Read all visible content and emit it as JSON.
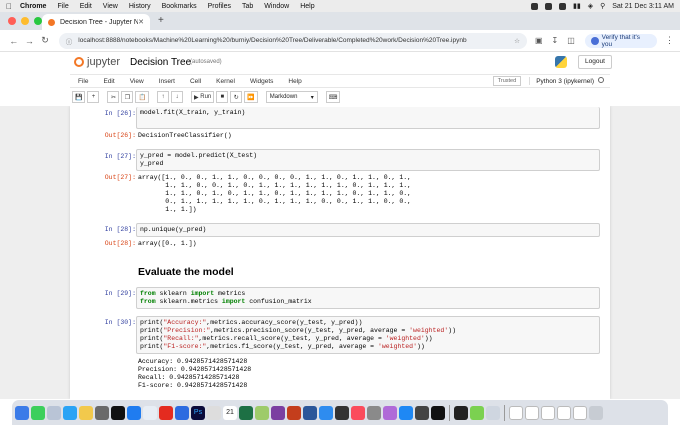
{
  "menubar": {
    "app": "Chrome",
    "items": [
      "File",
      "Edit",
      "View",
      "History",
      "Bookmarks",
      "Profiles",
      "Tab",
      "Window",
      "Help"
    ],
    "clock": "Sat 21 Dec  3:11 AM"
  },
  "browser": {
    "tab_title": "Decision Tree - Jupyter Notebo",
    "url": "localhost:8888/notebooks/Machine%20Learning%20/burniy/Decision%20Tree/Deliverable/Completed%20work/Decision%20Tree.ipynb",
    "verify_label": "Verify that it's you"
  },
  "jupyter": {
    "brand": "jupyter",
    "notebook_title": "Decision Tree",
    "save_status": "(autosaved)",
    "logout": "Logout",
    "menu": [
      "File",
      "Edit",
      "View",
      "Insert",
      "Cell",
      "Kernel",
      "Widgets",
      "Help"
    ],
    "trusted": "Trusted",
    "kernel": "Python 3 (ipykernel)",
    "run_label": "Run",
    "cell_type": "Markdown"
  },
  "cells": {
    "c26_in_prompt": "In [26]:",
    "c26_code": "model.fit(X_train, y_train)",
    "c26_out_prompt": "Out[26]:",
    "c26_output": "DecisionTreeClassifier()",
    "c27_in_prompt": "In [27]:",
    "c27_code": "y_pred = model.predict(X_test)\ny_pred",
    "c27_out_prompt": "Out[27]:",
    "c27_output": "array([1., 0., 0., 1., 1., 0., 0., 0., 0., 1., 1., 0., 1., 1., 0., 1.,\n       1., 1., 0., 0., 1., 0., 1., 1., 1., 1., 1., 1., 0., 1., 1., 1.,\n       1., 1., 0., 1., 0., 1., 1., 0., 1., 1., 1., 1., 0., 1., 1., 0.,\n       0., 1., 1., 1., 1., 1., 0., 1., 1., 1., 0., 0., 1., 1., 0., 0.,\n       1., 1.])",
    "c28_in_prompt": "In [28]:",
    "c28_code": "np.unique(y_pred)",
    "c28_out_prompt": "Out[28]:",
    "c28_output": "array([0., 1.])",
    "heading": "Evaluate the model",
    "c29_in_prompt": "In [29]:",
    "c29_line1_a": "from",
    "c29_line1_b": " sklearn ",
    "c29_line1_c": "import",
    "c29_line1_d": " metrics",
    "c29_line2_a": "from",
    "c29_line2_b": " sklearn.metrics ",
    "c29_line2_c": "import",
    "c29_line2_d": " confusion_matrix",
    "c30_in_prompt": "In [30]:",
    "c30_l1_pre": "print(",
    "c30_l1_str": "\"Accuracy:\"",
    "c30_l1_post": ",metrics.accuracy_score(y_test, y_pred))",
    "c30_l2_pre": "print(",
    "c30_l2_str": "\"Precision:\"",
    "c30_l2_mid": ",metrics.precision_score(y_test, y_pred, average = ",
    "c30_l2_str2": "'weighted'",
    "c30_l2_post": "))",
    "c30_l3_pre": "print(",
    "c30_l3_str": "\"Recall:\"",
    "c30_l3_mid": ",metrics.recall_score(y_test, y_pred, average = ",
    "c30_l3_str2": "'weighted'",
    "c30_l3_post": "))",
    "c30_l4_pre": "print(",
    "c30_l4_str": "\"F1-score:\"",
    "c30_l4_mid": ",metrics.f1_score(y_test, y_pred, average = ",
    "c30_l4_str2": "'weighted'",
    "c30_l4_post": "))",
    "c30_output": "Accuracy: 0.9428571428571428\nPrecision: 0.9428571428571428\nRecall: 0.9428571428571428\nF1-score: 0.9428571428571428"
  },
  "dock_calendar_day": "21",
  "colors": {
    "in_prompt": "#303f9f",
    "out_prompt": "#d84315",
    "keyword": "#008000",
    "string": "#ba2121",
    "jupyter_orange": "#f37726"
  }
}
